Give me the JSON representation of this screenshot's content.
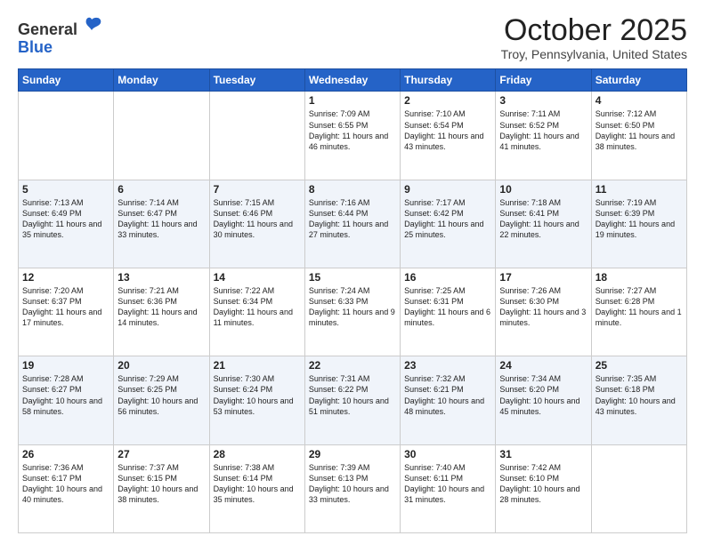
{
  "header": {
    "logo_general": "General",
    "logo_blue": "Blue",
    "month": "October 2025",
    "location": "Troy, Pennsylvania, United States"
  },
  "weekdays": [
    "Sunday",
    "Monday",
    "Tuesday",
    "Wednesday",
    "Thursday",
    "Friday",
    "Saturday"
  ],
  "weeks": [
    [
      {
        "day": "",
        "info": ""
      },
      {
        "day": "",
        "info": ""
      },
      {
        "day": "",
        "info": ""
      },
      {
        "day": "1",
        "info": "Sunrise: 7:09 AM\nSunset: 6:55 PM\nDaylight: 11 hours\nand 46 minutes."
      },
      {
        "day": "2",
        "info": "Sunrise: 7:10 AM\nSunset: 6:54 PM\nDaylight: 11 hours\nand 43 minutes."
      },
      {
        "day": "3",
        "info": "Sunrise: 7:11 AM\nSunset: 6:52 PM\nDaylight: 11 hours\nand 41 minutes."
      },
      {
        "day": "4",
        "info": "Sunrise: 7:12 AM\nSunset: 6:50 PM\nDaylight: 11 hours\nand 38 minutes."
      }
    ],
    [
      {
        "day": "5",
        "info": "Sunrise: 7:13 AM\nSunset: 6:49 PM\nDaylight: 11 hours\nand 35 minutes."
      },
      {
        "day": "6",
        "info": "Sunrise: 7:14 AM\nSunset: 6:47 PM\nDaylight: 11 hours\nand 33 minutes."
      },
      {
        "day": "7",
        "info": "Sunrise: 7:15 AM\nSunset: 6:46 PM\nDaylight: 11 hours\nand 30 minutes."
      },
      {
        "day": "8",
        "info": "Sunrise: 7:16 AM\nSunset: 6:44 PM\nDaylight: 11 hours\nand 27 minutes."
      },
      {
        "day": "9",
        "info": "Sunrise: 7:17 AM\nSunset: 6:42 PM\nDaylight: 11 hours\nand 25 minutes."
      },
      {
        "day": "10",
        "info": "Sunrise: 7:18 AM\nSunset: 6:41 PM\nDaylight: 11 hours\nand 22 minutes."
      },
      {
        "day": "11",
        "info": "Sunrise: 7:19 AM\nSunset: 6:39 PM\nDaylight: 11 hours\nand 19 minutes."
      }
    ],
    [
      {
        "day": "12",
        "info": "Sunrise: 7:20 AM\nSunset: 6:37 PM\nDaylight: 11 hours\nand 17 minutes."
      },
      {
        "day": "13",
        "info": "Sunrise: 7:21 AM\nSunset: 6:36 PM\nDaylight: 11 hours\nand 14 minutes."
      },
      {
        "day": "14",
        "info": "Sunrise: 7:22 AM\nSunset: 6:34 PM\nDaylight: 11 hours\nand 11 minutes."
      },
      {
        "day": "15",
        "info": "Sunrise: 7:24 AM\nSunset: 6:33 PM\nDaylight: 11 hours\nand 9 minutes."
      },
      {
        "day": "16",
        "info": "Sunrise: 7:25 AM\nSunset: 6:31 PM\nDaylight: 11 hours\nand 6 minutes."
      },
      {
        "day": "17",
        "info": "Sunrise: 7:26 AM\nSunset: 6:30 PM\nDaylight: 11 hours\nand 3 minutes."
      },
      {
        "day": "18",
        "info": "Sunrise: 7:27 AM\nSunset: 6:28 PM\nDaylight: 11 hours\nand 1 minute."
      }
    ],
    [
      {
        "day": "19",
        "info": "Sunrise: 7:28 AM\nSunset: 6:27 PM\nDaylight: 10 hours\nand 58 minutes."
      },
      {
        "day": "20",
        "info": "Sunrise: 7:29 AM\nSunset: 6:25 PM\nDaylight: 10 hours\nand 56 minutes."
      },
      {
        "day": "21",
        "info": "Sunrise: 7:30 AM\nSunset: 6:24 PM\nDaylight: 10 hours\nand 53 minutes."
      },
      {
        "day": "22",
        "info": "Sunrise: 7:31 AM\nSunset: 6:22 PM\nDaylight: 10 hours\nand 51 minutes."
      },
      {
        "day": "23",
        "info": "Sunrise: 7:32 AM\nSunset: 6:21 PM\nDaylight: 10 hours\nand 48 minutes."
      },
      {
        "day": "24",
        "info": "Sunrise: 7:34 AM\nSunset: 6:20 PM\nDaylight: 10 hours\nand 45 minutes."
      },
      {
        "day": "25",
        "info": "Sunrise: 7:35 AM\nSunset: 6:18 PM\nDaylight: 10 hours\nand 43 minutes."
      }
    ],
    [
      {
        "day": "26",
        "info": "Sunrise: 7:36 AM\nSunset: 6:17 PM\nDaylight: 10 hours\nand 40 minutes."
      },
      {
        "day": "27",
        "info": "Sunrise: 7:37 AM\nSunset: 6:15 PM\nDaylight: 10 hours\nand 38 minutes."
      },
      {
        "day": "28",
        "info": "Sunrise: 7:38 AM\nSunset: 6:14 PM\nDaylight: 10 hours\nand 35 minutes."
      },
      {
        "day": "29",
        "info": "Sunrise: 7:39 AM\nSunset: 6:13 PM\nDaylight: 10 hours\nand 33 minutes."
      },
      {
        "day": "30",
        "info": "Sunrise: 7:40 AM\nSunset: 6:11 PM\nDaylight: 10 hours\nand 31 minutes."
      },
      {
        "day": "31",
        "info": "Sunrise: 7:42 AM\nSunset: 6:10 PM\nDaylight: 10 hours\nand 28 minutes."
      },
      {
        "day": "",
        "info": ""
      }
    ]
  ]
}
